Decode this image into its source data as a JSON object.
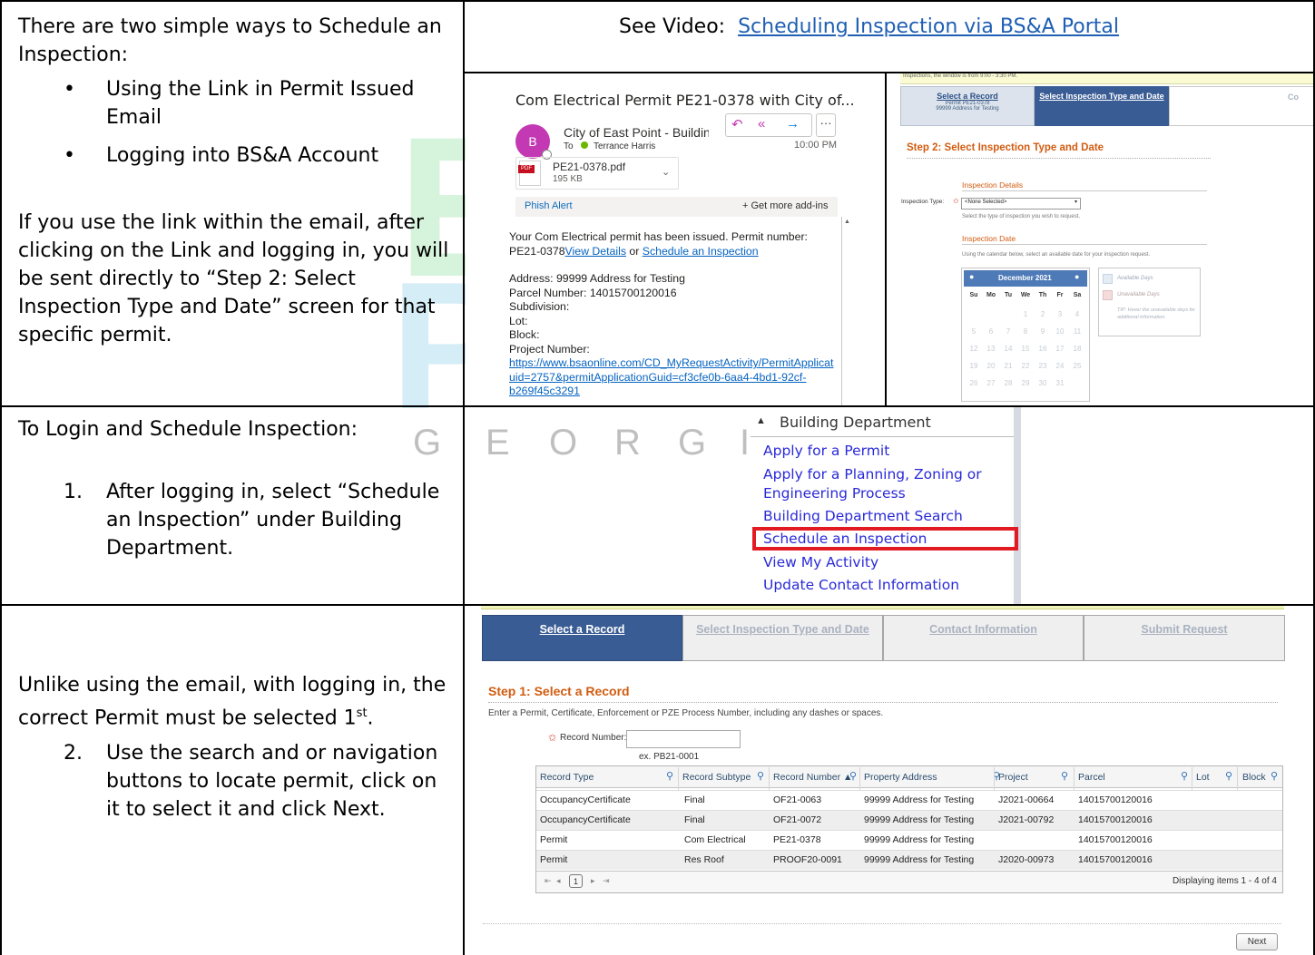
{
  "watermark": {
    "letters": [
      "E",
      "P",
      "T"
    ],
    "georgia": [
      "G",
      "E",
      "O",
      "R",
      "G",
      "I"
    ]
  },
  "row1": {
    "intro": "There are two simple ways to Schedule an Inspection:",
    "bullets": [
      "Using the Link in Permit Issued Email",
      "Logging into BS&A Account"
    ],
    "para": "If you use the link within the email, after clicking on the Link and logging in, you will be sent directly to “Step 2: Select Inspection Type and Date” screen for that specific permit.",
    "video_prefix": "See Video:",
    "video_link": "Scheduling Inspection via BS&A Portal"
  },
  "email": {
    "subject": "Com Electrical Permit PE21-0378 with City of...",
    "avatar": "B",
    "sender": "City of East Point - Building",
    "to_label": "To",
    "to_name": "Terrance Harris",
    "time": "10:00 PM",
    "attachment_name": "PE21-0378.pdf",
    "attachment_size": "195 KB",
    "pdf_badge": "PDF",
    "phish": "Phish Alert",
    "addins": "+ Get more add-ins",
    "body_intro": "Your Com Electrical permit has been issued. Permit number: PE21-0378",
    "view_details": "View Details",
    "or": "or",
    "schedule_link": "Schedule an Inspection",
    "address": "Address: 99999 Address for Testing",
    "parcel": "Parcel Number: 14015700120016",
    "subdivision": "Subdivision:",
    "lot": "Lot:",
    "block": "Block:",
    "project": "Project Number:",
    "url1": "https://www.bsaonline.com/CD_MyRequestActivity/PermitApplicat",
    "url2": "uid=2757&permitApplicationGuid=cf3cfe0b-6aa4-4bd1-92cf-",
    "url3": "b269f45c3291"
  },
  "step2": {
    "banner": "Inspections, the window is from 9:00 - 3:30 PM.",
    "tab1_title": "Select a Record",
    "tab1_sub1": "Permit PE21-0378",
    "tab1_sub2": "99999 Address for Testing",
    "tab2_title": "Select Inspection Type and Date",
    "tab3_title": "Co",
    "heading": "Step 2: Select Inspection Type and Date",
    "details_title": "Inspection Details",
    "type_label": "Inspection Type:",
    "type_value": "<None Selected>",
    "type_help": "Select the type of inspection you wish to request.",
    "date_title": "Inspection Date",
    "date_help": "Using the calendar below, select an available date for your inspection request.",
    "month": "December 2021",
    "days": [
      "Su",
      "Mo",
      "Tu",
      "We",
      "Th",
      "Fr",
      "Sa"
    ],
    "weeks": [
      [
        "",
        "",
        "",
        "1",
        "2",
        "3",
        "4"
      ],
      [
        "5",
        "6",
        "7",
        "8",
        "9",
        "10",
        "11"
      ],
      [
        "12",
        "13",
        "14",
        "15",
        "16",
        "17",
        "18"
      ],
      [
        "19",
        "20",
        "21",
        "22",
        "23",
        "24",
        "25"
      ],
      [
        "26",
        "27",
        "28",
        "29",
        "30",
        "31",
        ""
      ]
    ],
    "legend_available": "Available Days",
    "legend_unavailable": "Unavailable Days",
    "legend_tip": "TIP: Hover the unavailable days for additional information."
  },
  "row2": {
    "intro": "To Login and Schedule Inspection:",
    "step_num": "1.",
    "step_text": "After logging in, select “Schedule an Inspection” under Building Department."
  },
  "menu": {
    "header": "Building Department",
    "items": [
      "Apply for a Permit",
      "Apply for a Planning, Zoning or",
      "Engineering Process",
      "Building Department Search",
      "Schedule an Inspection",
      "View My Activity",
      "Update Contact Information"
    ]
  },
  "row3": {
    "para_a": "Unlike using the email, with logging in, the correct Permit must be selected 1",
    "para_sup": "st",
    "para_b": ".",
    "step_num": "2.",
    "step_text": "Use the search and or navigation buttons to locate permit, click on it to select it and click Next."
  },
  "step1": {
    "tabs": [
      "Select a Record",
      "Select Inspection Type and Date",
      "Contact Information",
      "Submit Request"
    ],
    "heading": "Step 1: Select a Record",
    "instructions": "Enter a Permit, Certificate, Enforcement or PZE Process Number, including any dashes or spaces.",
    "record_label": "Record Number:",
    "record_value": "",
    "example": "ex. PB21-0001",
    "columns": [
      "Record Type",
      "Record Subtype",
      "Record Number ▲",
      "Property Address",
      "Project",
      "Parcel",
      "Lot",
      "Block"
    ],
    "rows": [
      [
        "OccupancyCertificate",
        "Final",
        "OF21-0063",
        "99999 Address for Testing",
        "J2021-00664",
        "14015700120016",
        "",
        ""
      ],
      [
        "OccupancyCertificate",
        "Final",
        "OF21-0072",
        "99999 Address for Testing",
        "J2021-00792",
        "14015700120016",
        "",
        ""
      ],
      [
        "Permit",
        "Com Electrical",
        "PE21-0378",
        "99999 Address for Testing",
        "",
        "14015700120016",
        "",
        ""
      ],
      [
        "Permit",
        "Res Roof",
        "PROOF20-0091",
        "99999 Address for Testing",
        "J2020-00973",
        "14015700120016",
        "",
        ""
      ]
    ],
    "pager_page": "1",
    "pager_summary": "Displaying items 1 - 4 of 4",
    "next": "Next"
  }
}
